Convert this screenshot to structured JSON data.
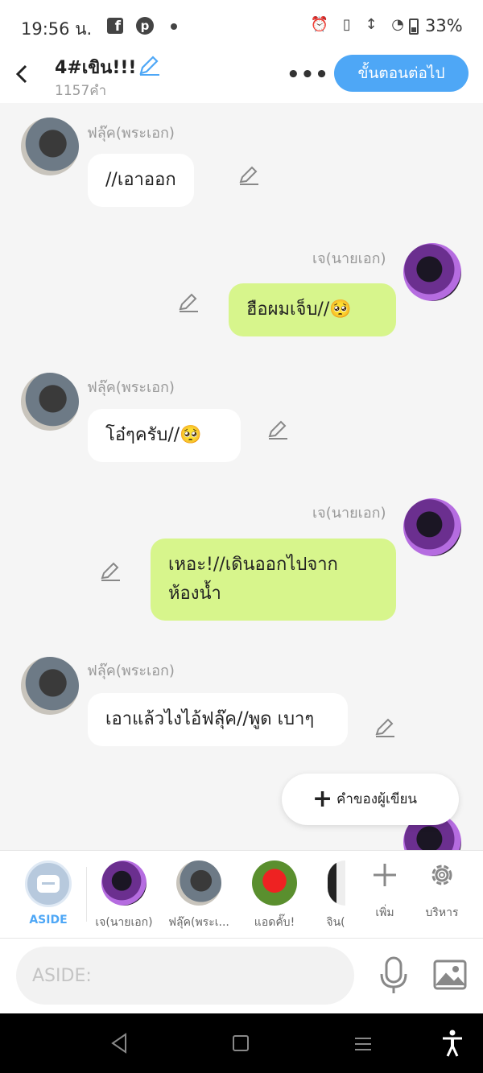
{
  "status_bar": {
    "time": "19:56 น.",
    "battery": "33%"
  },
  "header": {
    "title": "4#เขิน!!!",
    "word_count": "1157คำ",
    "next_button": "ขั้นตอนต่อไป",
    "accent_color": "#4ea7f6"
  },
  "messages": [
    {
      "side": "left",
      "name": "ฟลุ๊ค(พระเอก)",
      "text": "//เอาออก"
    },
    {
      "side": "right",
      "name": "เจ(นายเอก)",
      "text": "ฮือผมเจ็บ//🥺"
    },
    {
      "side": "left",
      "name": "ฟลุ๊ค(พระเอก)",
      "text": "โอ๋ๆครับ//🥺"
    },
    {
      "side": "right",
      "name": "เจ(นายเอก)",
      "text": "เหอะ!//เดินออกไปจาก ห้องน้ำ"
    },
    {
      "side": "left",
      "name": "ฟลุ๊ค(พระเอก)",
      "text": "เอาแล้วไงไอ้ฟลุ๊ค//พูด เบาๆ"
    }
  ],
  "fab": {
    "label": "คำของผู้เขียน"
  },
  "character_bar": {
    "aside_label": "ASIDE",
    "characters": [
      "เจ(นายเอก)",
      "ฟลุ๊ค(พระเ...",
      "แอดคั๊บ!",
      "จิน("
    ],
    "add_label": "เพิ่ม",
    "manage_label": "บริหาร"
  },
  "input": {
    "placeholder": "ASIDE:"
  },
  "colors": {
    "left_bubble": "#ffffff",
    "right_bubble": "#d7f58c",
    "background": "#f5f5f5"
  }
}
